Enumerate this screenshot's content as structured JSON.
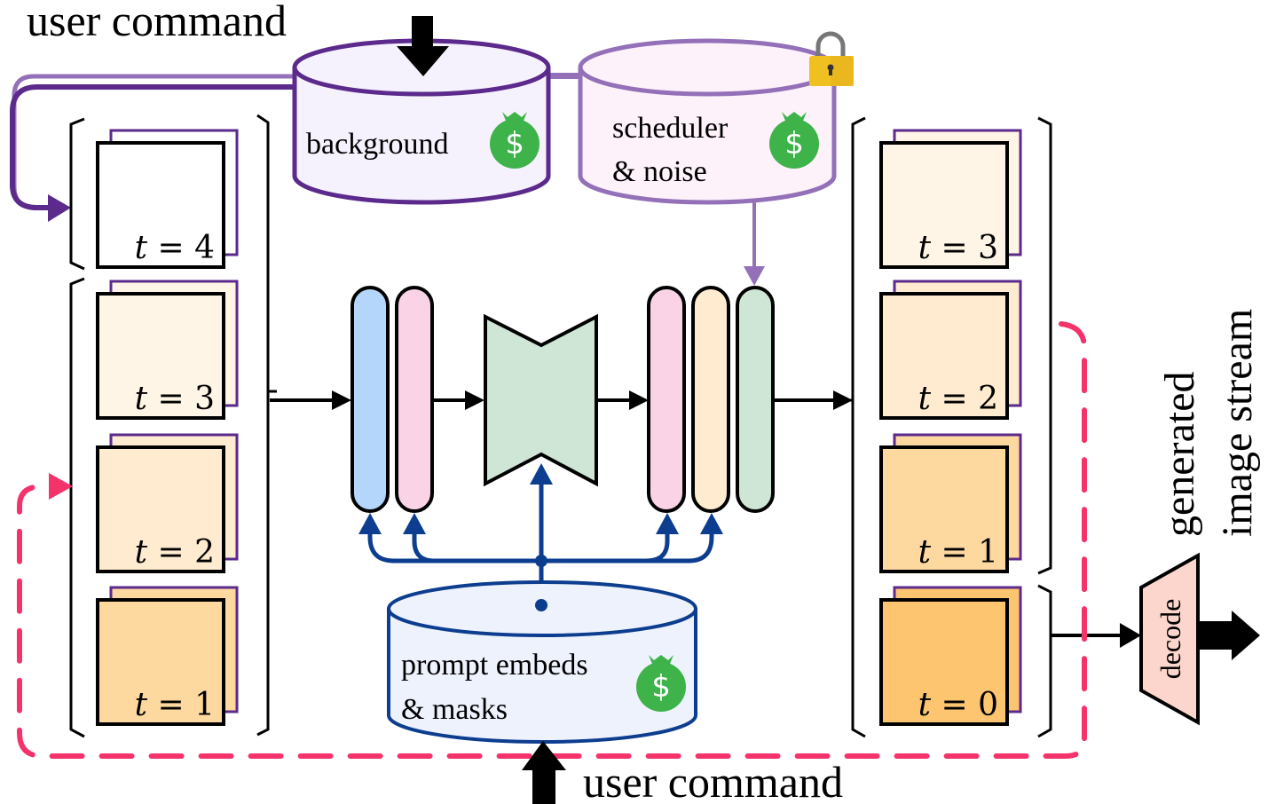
{
  "labels": {
    "user_command_top": "user command",
    "user_command_bottom": "user command",
    "output_line1": "generated",
    "output_line2": "image stream",
    "decode": "decode"
  },
  "stores": {
    "background": {
      "label": "background",
      "cost_icon": "money-bag-icon"
    },
    "scheduler": {
      "line1": "scheduler",
      "line2": "& noise",
      "cost_icon": "money-bag-icon",
      "lock_icon": "padlock-icon"
    },
    "prompt": {
      "line1": "prompt embeds",
      "line2": "& masks",
      "cost_icon": "money-bag-icon"
    }
  },
  "input_frames": [
    {
      "label": "t = 4",
      "var": "t",
      "value": "4",
      "fill": "#ffffff"
    },
    {
      "label": "t = 3",
      "var": "t",
      "value": "3",
      "fill": "#fff5e6"
    },
    {
      "label": "t = 2",
      "var": "t",
      "value": "2",
      "fill": "#ffebd0"
    },
    {
      "label": "t = 1",
      "var": "t",
      "value": "1",
      "fill": "#fdd9a0"
    }
  ],
  "output_frames": [
    {
      "label": "t = 3",
      "var": "t",
      "value": "3",
      "fill": "#fff5e6"
    },
    {
      "label": "t = 2",
      "var": "t",
      "value": "2",
      "fill": "#ffebd0"
    },
    {
      "label": "t = 1",
      "var": "t",
      "value": "1",
      "fill": "#fdd9a0"
    },
    {
      "label": "t = 0",
      "var": "t",
      "value": "0",
      "fill": "#fdc570"
    }
  ],
  "colors": {
    "purple_dark": "#5b2a8c",
    "purple_light": "#9370b8",
    "blue_dark": "#0d3d8f",
    "pink_dash": "#f5336b",
    "money_green": "#3db34a",
    "lock_gold": "#f0c020",
    "bar_blue": "#b4d6fa",
    "bar_pink": "#fad4e6",
    "bar_orange": "#ffecd0",
    "bar_green": "#cfe5d6",
    "unet_green": "#cfe5d6",
    "decode_fill": "#fcd5cc",
    "bg_store_fill": "#f6f2fd",
    "sched_store_fill": "#fdf2fa",
    "prompt_store_fill": "#eef2fc"
  },
  "pipeline_blocks": [
    "blue-layer",
    "pink-layer",
    "unet",
    "pink-layer",
    "orange-layer",
    "green-layer"
  ]
}
